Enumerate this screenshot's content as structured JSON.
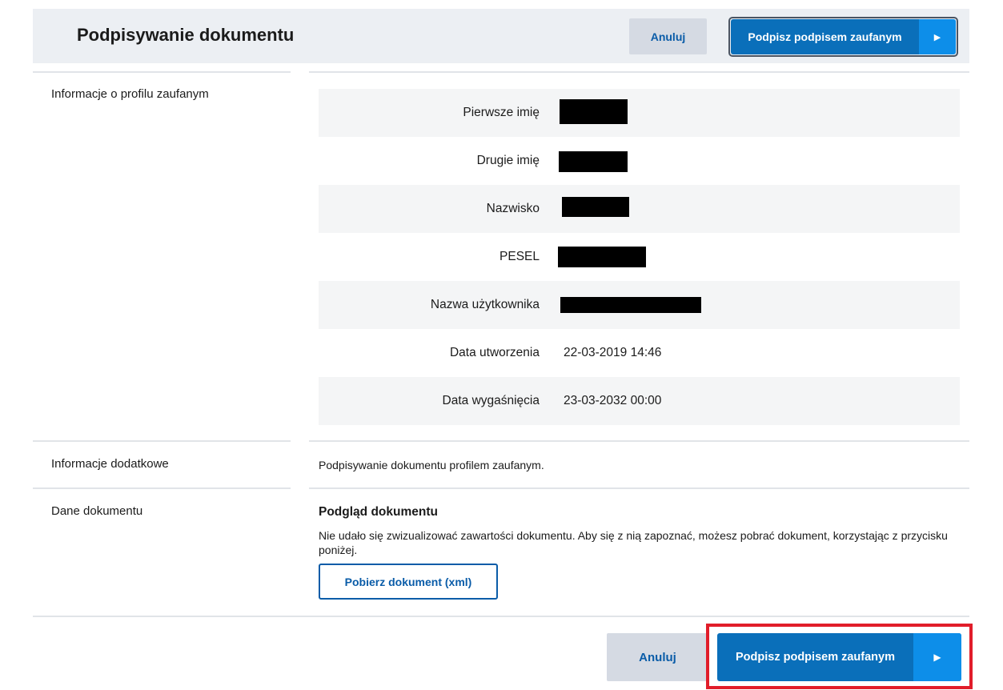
{
  "header": {
    "title": "Podpisywanie dokumentu",
    "cancel_label": "Anuluj",
    "sign_label": "Podpisz podpisem zaufanym",
    "sign_arrow": "▶"
  },
  "profile": {
    "section_label": "Informacje o profilu zaufanym",
    "fields": [
      {
        "label": "Pierwsze imię",
        "value": ""
      },
      {
        "label": "Drugie imię",
        "value": ""
      },
      {
        "label": "Nazwisko",
        "value": ""
      },
      {
        "label": "PESEL",
        "value": ""
      },
      {
        "label": "Nazwa użytkownika",
        "value": ""
      },
      {
        "label": "Data utworzenia",
        "value": "22-03-2019 14:46"
      },
      {
        "label": "Data wygaśnięcia",
        "value": "23-03-2032 00:00"
      }
    ]
  },
  "additional": {
    "section_label": "Informacje dodatkowe",
    "text": "Podpisywanie dokumentu profilem zaufanym."
  },
  "document": {
    "section_label": "Dane dokumentu",
    "preview_title": "Podgląd dokumentu",
    "preview_desc": "Nie udało się zwizualizować zawartości dokumentu. Aby się z nią zapoznać, możesz pobrać dokument, korzystając z przycisku poniżej.",
    "download_label": "Pobierz dokument (xml)"
  },
  "footer": {
    "cancel_label": "Anuluj",
    "sign_label": "Podpisz podpisem zaufanym",
    "sign_arrow": "▶"
  },
  "colors": {
    "primary": "#0a6fba",
    "primary_arrow": "#0d8ee9",
    "cancel_bg": "#d5dae3",
    "link": "#0a5ca8",
    "highlight": "#e11d2a"
  }
}
